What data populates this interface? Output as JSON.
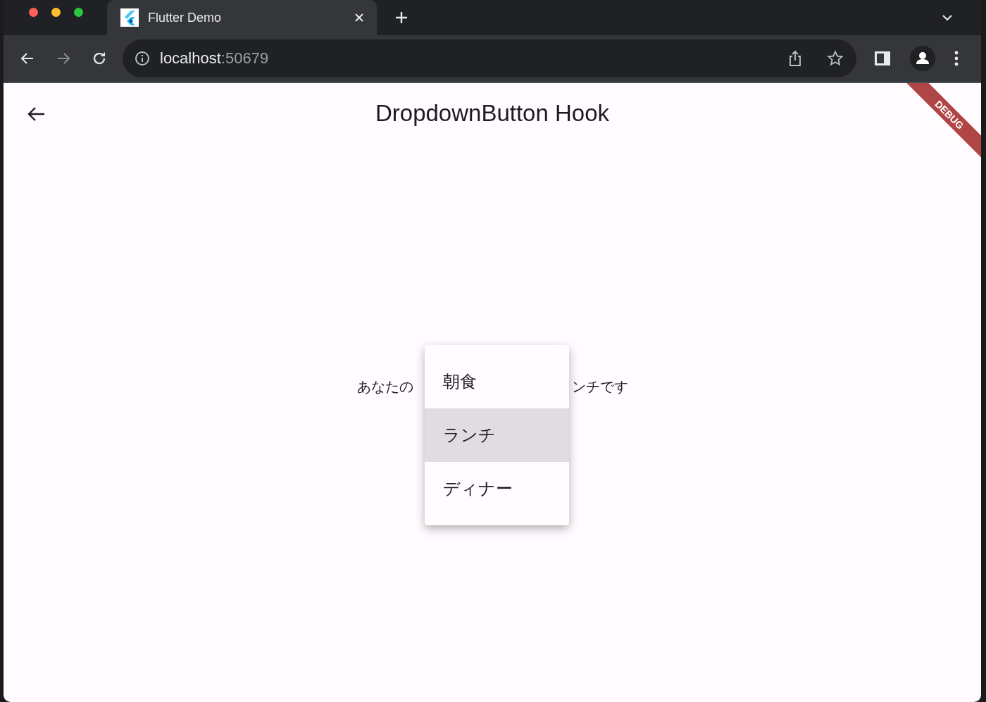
{
  "browser": {
    "tabs": [
      {
        "title": "Flutter Demo",
        "selected": true
      }
    ],
    "address": {
      "host": "localhost",
      "port": ":50679"
    }
  },
  "app": {
    "title": "DropdownButton Hook",
    "debug_banner": "DEBUG",
    "selection_text": {
      "before": "あなたの",
      "after": "ンチです"
    },
    "menu": {
      "items": [
        {
          "label": "朝食",
          "selected": false
        },
        {
          "label": "ランチ",
          "selected": true
        },
        {
          "label": "ディナー",
          "selected": false
        }
      ]
    }
  }
}
